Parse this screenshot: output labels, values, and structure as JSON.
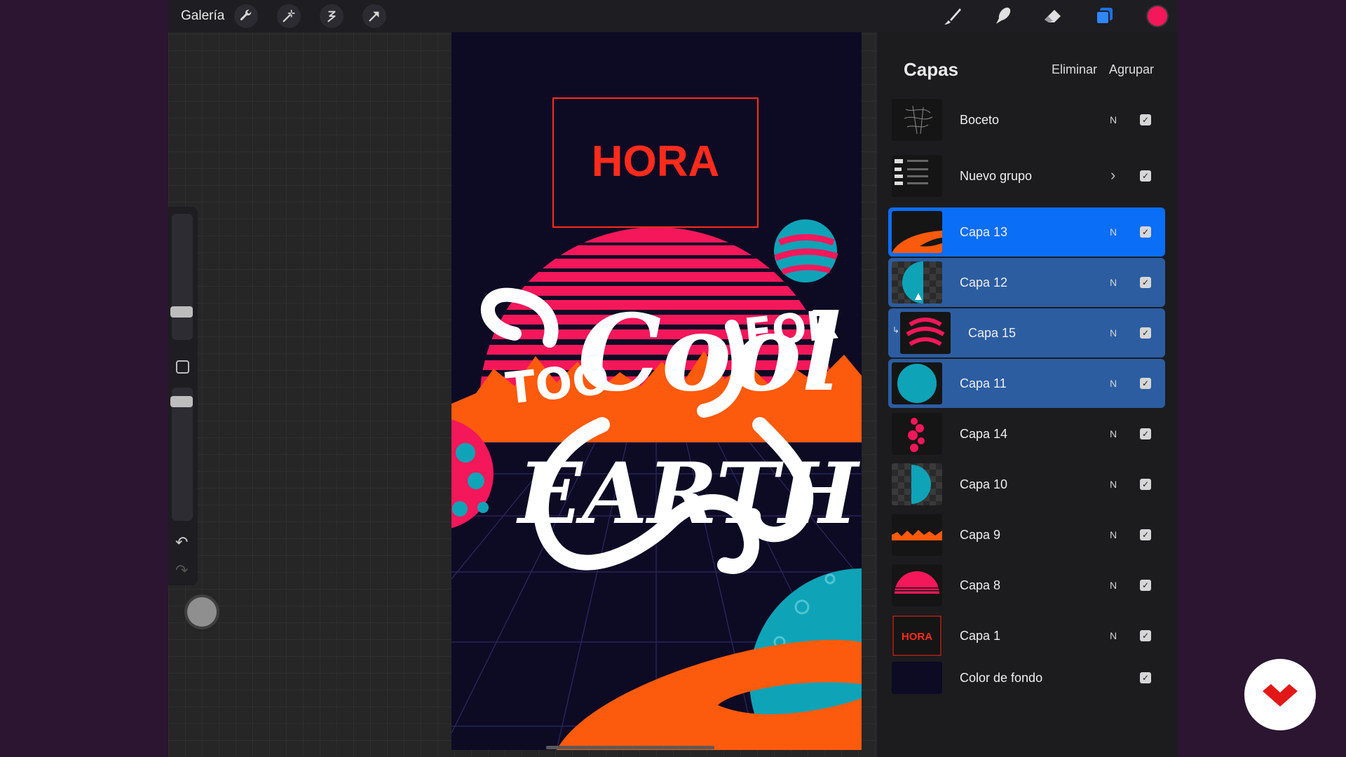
{
  "toolbar": {
    "gallery_label": "Galería",
    "left_icons": [
      "wrench-icon",
      "magic-wand-icon",
      "selection-icon",
      "transform-arrow-icon"
    ],
    "right_icons": [
      "brush-icon",
      "smudge-icon",
      "eraser-icon",
      "layers-icon"
    ],
    "current_color": "#f4175a"
  },
  "canvas": {
    "hora_text": "HORA",
    "lettering_words": [
      "TOO",
      "Cool",
      "FOR",
      "EARTH"
    ],
    "colors": {
      "background": "#0d0a24",
      "pink": "#f4175a",
      "orange": "#fc5a0c",
      "teal": "#0fa3b8",
      "red": "#ff2b1c",
      "white": "#ffffff"
    }
  },
  "layers_panel": {
    "title": "Capas",
    "delete_label": "Eliminar",
    "group_label": "Agrupar",
    "layers": [
      {
        "name": "Boceto",
        "mode": "N",
        "visible": true,
        "state": "normal"
      },
      {
        "name": "Nuevo grupo",
        "mode": "",
        "visible": true,
        "state": "normal",
        "group": true
      },
      {
        "name": "Capa 13",
        "mode": "N",
        "visible": true,
        "state": "active"
      },
      {
        "name": "Capa 12",
        "mode": "N",
        "visible": true,
        "state": "selected"
      },
      {
        "name": "Capa 15",
        "mode": "N",
        "visible": true,
        "state": "selected",
        "clipped": true
      },
      {
        "name": "Capa 11",
        "mode": "N",
        "visible": true,
        "state": "selected"
      },
      {
        "name": "Capa 14",
        "mode": "N",
        "visible": true,
        "state": "normal"
      },
      {
        "name": "Capa 10",
        "mode": "N",
        "visible": true,
        "state": "normal"
      },
      {
        "name": "Capa 9",
        "mode": "N",
        "visible": true,
        "state": "normal"
      },
      {
        "name": "Capa 8",
        "mode": "N",
        "visible": true,
        "state": "normal"
      },
      {
        "name": "Capa 1",
        "mode": "N",
        "visible": true,
        "state": "normal"
      },
      {
        "name": "Color de fondo",
        "mode": "",
        "visible": true,
        "state": "normal"
      }
    ],
    "thumb_texts": {
      "capa1": "HORA"
    }
  }
}
